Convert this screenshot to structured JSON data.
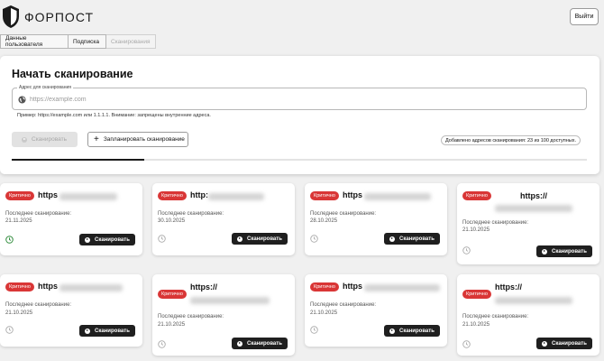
{
  "app": {
    "name": "ФОРПОСТ",
    "logout_label": "Выйти"
  },
  "tabs": [
    {
      "label": "Данные пользователя",
      "state": "normal"
    },
    {
      "label": "Подписка",
      "state": "normal"
    },
    {
      "label": "Сканирования",
      "state": "disabled"
    }
  ],
  "scan": {
    "title": "Начать сканирование",
    "field_label": "Адрес для сканирования",
    "placeholder": "https://example.com",
    "value": "",
    "hint": "Пример: https://example.com или 1.1.1.1. Внимание: запрещены внутренние адреса.",
    "scan_button_label": "Сканировать",
    "schedule_button_label": "Запланировать сканирование",
    "quota_text": "Добавлено адресов сканирования: 23 из 100 доступных.",
    "progress_fraction": 0.23
  },
  "cards_common": {
    "badge": "Критично",
    "last_scan_label": "Последнее сканирование:",
    "scan_button_label": "Сканировать"
  },
  "cards": [
    {
      "host": "https",
      "date": "21.11.2025",
      "status": "success"
    },
    {
      "host": "http:",
      "date": "30.10.2025",
      "status": "idle"
    },
    {
      "host": "https",
      "date": "28.10.2025",
      "status": "idle"
    },
    {
      "host": "https://",
      "date": "21.10.2025",
      "status": "idle"
    },
    {
      "host": "https",
      "date": "21.10.2025",
      "status": "idle"
    },
    {
      "host": "https://",
      "date": "21.10.2025",
      "status": "idle"
    },
    {
      "host": "https",
      "date": "21.10.2025",
      "status": "idle"
    },
    {
      "host": "https://",
      "date": "21.10.2025",
      "status": "idle"
    }
  ],
  "colors": {
    "badge": "#d93636",
    "success_icon": "#2e8b3a",
    "button_dark": "#1f1f1f"
  }
}
